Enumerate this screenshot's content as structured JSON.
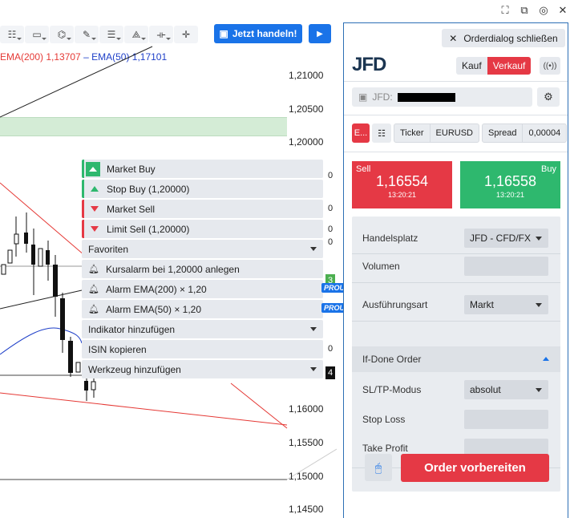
{
  "window_controls": {
    "icons": [
      "fullscreen-icon",
      "popout-icon",
      "settings-icon",
      "close-icon"
    ]
  },
  "toolbar": {
    "tools": [
      "indicator-icon",
      "rectangle-icon",
      "shapes-icon",
      "pencil-icon",
      "fibonacci-icon",
      "pattern-icon",
      "measure-icon",
      "crosshair-icon"
    ],
    "trade_label": "Jetzt handeln!"
  },
  "chart": {
    "legend_ema200": "EMA(200)  1,13707",
    "legend_ema50": "EMA(50)  1,17101",
    "price_labels": [
      "1,21000",
      "1,20500",
      "1,20000",
      "1,16000",
      "1,15500",
      "1,15000",
      "1,14500"
    ],
    "side_marks": [
      "0",
      "0",
      "0",
      "0",
      "0",
      "3",
      "0",
      "4"
    ],
    "colors": {
      "ema200": "#e53935",
      "ema50": "#1e3fc8",
      "zone": "#d4ecd6"
    }
  },
  "menu": {
    "market_buy": "Market Buy",
    "stop_buy": "Stop Buy (1,20000)",
    "market_sell": "Market Sell",
    "limit_sell": "Limit Sell (1,20000)",
    "favoriten": "Favoriten",
    "kursalarm": "Kursalarm bei 1,20000 anlegen",
    "alarm_ema200": "Alarm EMA(200) × 1,20",
    "alarm_ema50": "Alarm EMA(50) × 1,20",
    "indikator": "Indikator hinzufügen",
    "isin": "ISIN kopieren",
    "werkzeug": "Werkzeug hinzufügen",
    "badge": "PROUP"
  },
  "panel": {
    "close_label": "Orderdialog schließen",
    "logo": "JFD",
    "kauf": "Kauf",
    "verkauf": "Verkauf",
    "account_prefix": "JFD:",
    "tk_red": "E...",
    "ticker_label": "Ticker",
    "ticker_value": "EURUSD",
    "spread_label": "Spread",
    "spread_value": "0,00004",
    "sell": {
      "label": "Sell",
      "price": "1,16554",
      "time": "13:20:21"
    },
    "buy": {
      "label": "Buy",
      "price": "1,16558",
      "time": "13:20:21"
    },
    "form": {
      "handelsplatz_label": "Handelsplatz",
      "handelsplatz_value": "JFD - CFD/FX",
      "volumen_label": "Volumen",
      "ausfuehrung_label": "Ausführungsart",
      "ausfuehrung_value": "Markt",
      "ifdone_label": "If-Done Order",
      "sltp_label": "SL/TP-Modus",
      "sltp_value": "absolut",
      "stoploss_label": "Stop Loss",
      "takeprofit_label": "Take Profit"
    },
    "order_button": "Order vorbereiten"
  }
}
